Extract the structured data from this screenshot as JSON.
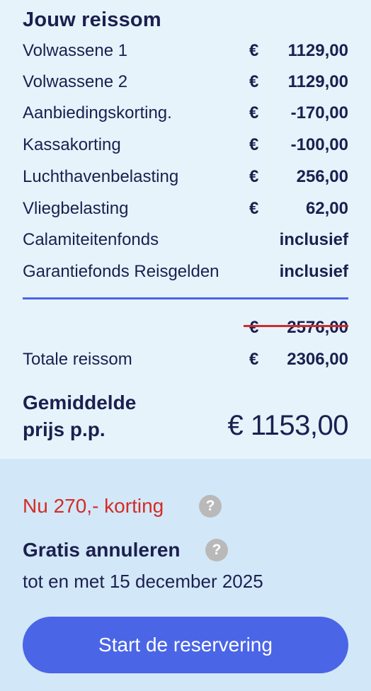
{
  "summary": {
    "title": "Jouw reissom",
    "rows": [
      {
        "label": "Volwassene 1",
        "currency": "€",
        "amount": "1129,00"
      },
      {
        "label": "Volwassene 2",
        "currency": "€",
        "amount": "1129,00"
      },
      {
        "label": "Aanbiedingskorting.",
        "currency": "€",
        "amount": "-170,00"
      },
      {
        "label": "Kassakorting",
        "currency": "€",
        "amount": "-100,00"
      },
      {
        "label": "Luchthavenbelasting",
        "currency": "€",
        "amount": "256,00"
      },
      {
        "label": "Vliegbelasting",
        "currency": "€",
        "amount": "62,00"
      },
      {
        "label": "Calamiteitenfonds",
        "currency": "",
        "amount": "inclusief"
      },
      {
        "label": "Garantiefonds Reisgelden",
        "currency": "",
        "amount": "inclusief"
      }
    ],
    "original_total": {
      "currency": "€",
      "amount": "2576,00"
    },
    "total": {
      "label": "Totale reissom",
      "currency": "€",
      "amount": "2306,00"
    },
    "average": {
      "label_line1": "Gemiddelde",
      "label_line2": "prijs p.p.",
      "price": "€ 1153,00"
    }
  },
  "promo": {
    "discount_text": "Nu 270,- korting",
    "help_glyph": "?",
    "cancel_title": "Gratis annuleren",
    "cancel_until": "tot en met 15 december 2025",
    "cta_label": "Start de reservering"
  },
  "colors": {
    "accent": "#4a65e6",
    "discount_red": "#cf2b2b",
    "panel_top": "#e6f3fb",
    "panel_bottom": "#d2e8f8",
    "text": "#1c1f4f"
  }
}
